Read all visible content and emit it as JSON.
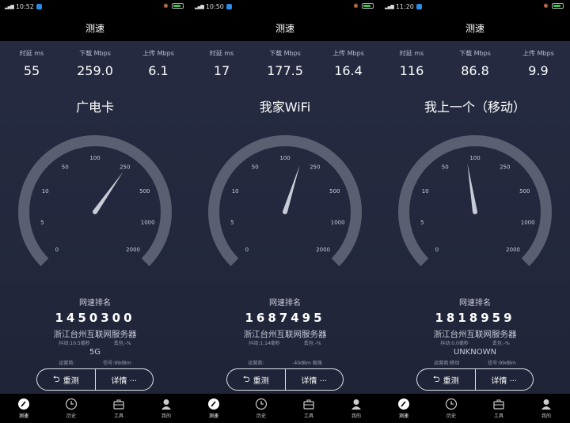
{
  "title": "测速",
  "labels": {
    "latency": "时延 ms",
    "download": "下载 Mbps",
    "upload": "上传 Mbps",
    "rank_title": "网速排名",
    "retest": "重测",
    "details": "详情 ···"
  },
  "gauge_ticks": [
    "0",
    "5",
    "10",
    "50",
    "100",
    "250",
    "500",
    "1000",
    "2000"
  ],
  "nav": [
    "测速",
    "历史",
    "工具",
    "我的"
  ],
  "colors": {
    "panel_bg": "#262b42",
    "gauge_track": "#5a5f72",
    "needle": "#c9ccd6"
  },
  "panels": [
    {
      "time": "10:52",
      "latency": "55",
      "download": "259.0",
      "upload": "6.1",
      "network": "广电卡",
      "download_value": 259.0,
      "rank": "1450300",
      "server": "浙江台州互联网服务器",
      "jitter": "抖动:10.5毫秒",
      "loss": "丢包:-%",
      "net_type": "5G",
      "carrier": "运营商:",
      "signal": "信号:99dBm"
    },
    {
      "time": "10:50",
      "latency": "17",
      "download": "177.5",
      "upload": "16.4",
      "network": "我家WiFi",
      "download_value": 177.5,
      "rank": "1687495",
      "server": "浙江台州互联网服务器",
      "jitter": "抖动:1.14毫秒",
      "loss": "丢包:-%",
      "net_type": "",
      "carrier": "运营商:",
      "signal": "-40dBm 极强"
    },
    {
      "time": "11:20",
      "latency": "116",
      "download": "86.8",
      "upload": "9.9",
      "network": "我上一个（移动）",
      "download_value": 86.8,
      "rank": "1818959",
      "server": "浙江台州互联网服务器",
      "jitter": "抖动:0.0毫秒",
      "loss": "丢包:-%",
      "net_type": "UNKNOWN",
      "carrier": "运营商:移动",
      "signal": "信号:99dBm"
    }
  ]
}
